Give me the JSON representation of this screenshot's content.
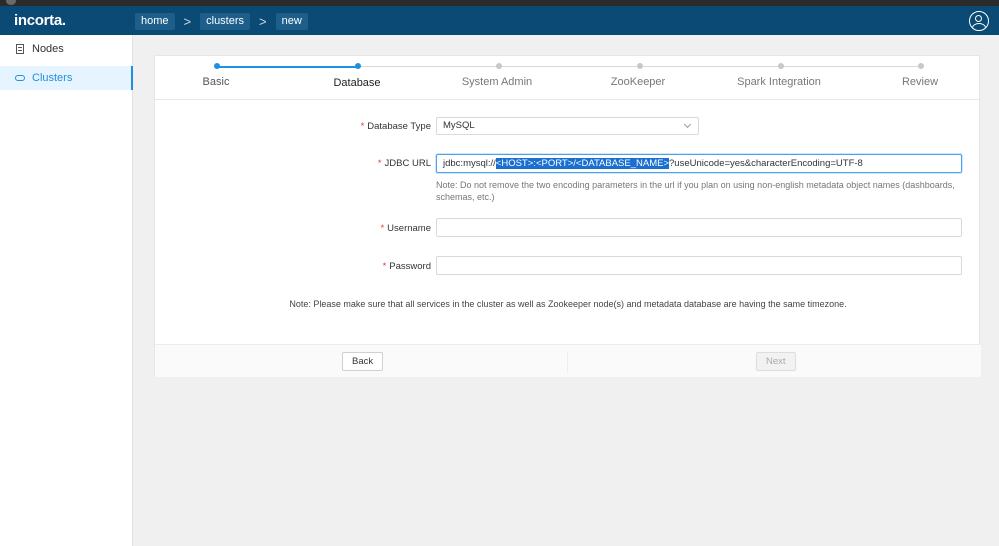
{
  "app": {
    "logo_text": "incorta."
  },
  "breadcrumb": [
    "home",
    "clusters",
    "new"
  ],
  "sidebar": {
    "items": [
      {
        "label": "Nodes",
        "icon": "nodes-icon"
      },
      {
        "label": "Clusters",
        "icon": "cloud-icon",
        "active": true
      }
    ]
  },
  "steps": [
    {
      "label": "Basic",
      "state": "done"
    },
    {
      "label": "Database",
      "state": "current"
    },
    {
      "label": "System Admin",
      "state": "pending"
    },
    {
      "label": "ZooKeeper",
      "state": "pending"
    },
    {
      "label": "Spark Integration",
      "state": "pending"
    },
    {
      "label": "Review",
      "state": "pending"
    }
  ],
  "form": {
    "db_type": {
      "label": "Database Type",
      "value": "MySQL"
    },
    "jdbc": {
      "label": "JDBC URL",
      "prefix": "jdbc:mysql://",
      "host": "<HOST>",
      "colon": ":",
      "port": "<PORT>",
      "slash": "/",
      "dbname": "<DATABASE_NAME>",
      "suffix": "?useUnicode=yes&characterEncoding=UTF-8",
      "note": "Note: Do not remove the two encoding parameters in the url if you plan on using non-english metadata object names (dashboards, schemas, etc.)"
    },
    "username": {
      "label": "Username",
      "value": ""
    },
    "password": {
      "label": "Password",
      "value": ""
    },
    "timezone_note": "Note: Please make sure that all services in the cluster as well as Zookeeper node(s) and metadata database are having the same timezone."
  },
  "buttons": {
    "back": "Back",
    "next": "Next"
  },
  "colors": {
    "header": "#0b4a74",
    "accent": "#1f8fe0",
    "required": "#e53935"
  }
}
